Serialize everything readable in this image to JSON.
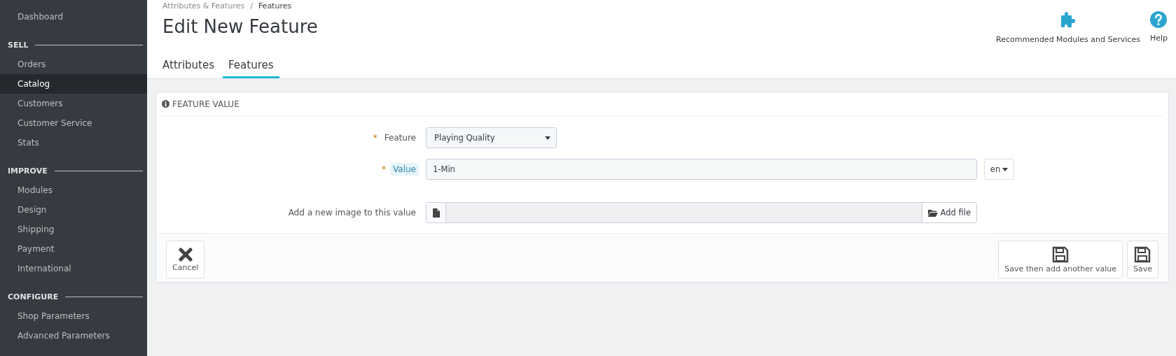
{
  "sidebar": {
    "items": [
      {
        "kind": "item",
        "label": "Dashboard",
        "selected": false
      },
      {
        "kind": "section",
        "label": "SELL"
      },
      {
        "kind": "item",
        "label": "Orders",
        "selected": false
      },
      {
        "kind": "item",
        "label": "Catalog",
        "selected": true
      },
      {
        "kind": "item",
        "label": "Customers",
        "selected": false
      },
      {
        "kind": "item",
        "label": "Customer Service",
        "selected": false
      },
      {
        "kind": "item",
        "label": "Stats",
        "selected": false
      },
      {
        "kind": "section",
        "label": "IMPROVE"
      },
      {
        "kind": "item",
        "label": "Modules",
        "selected": false
      },
      {
        "kind": "item",
        "label": "Design",
        "selected": false
      },
      {
        "kind": "item",
        "label": "Shipping",
        "selected": false
      },
      {
        "kind": "item",
        "label": "Payment",
        "selected": false
      },
      {
        "kind": "item",
        "label": "International",
        "selected": false
      },
      {
        "kind": "section",
        "label": "CONFIGURE"
      },
      {
        "kind": "item",
        "label": "Shop Parameters",
        "selected": false
      },
      {
        "kind": "item",
        "label": "Advanced Parameters",
        "selected": false
      }
    ]
  },
  "breadcrumb": [
    "Attributes & Features",
    "/",
    "Features"
  ],
  "title": "Edit New Feature",
  "toolbar": [
    {
      "kind": "puzzle",
      "label": "Recommended Modules and Services"
    },
    {
      "kind": "help",
      "label": "Help"
    }
  ],
  "tabs": [
    {
      "label": "Attributes",
      "selected": false
    },
    {
      "label": "Features",
      "selected": true
    }
  ],
  "panel": {
    "heading": "FEATURE VALUE",
    "fields": [
      {
        "kind": "select",
        "marker": "*",
        "label": "Feature",
        "highlighted": false,
        "value": "Playing Quality"
      },
      {
        "kind": "text",
        "marker": "*",
        "label": "Value",
        "highlighted": true,
        "value": "1-Min",
        "language": "en"
      },
      {
        "kind": "file",
        "label": "Add a new image to this value",
        "highlighted": false,
        "button": "Add file"
      }
    ],
    "buttons": [
      {
        "kind": "cancel",
        "label": "Cancel"
      },
      {
        "kind": "save",
        "label": "Save then add another value"
      },
      {
        "kind": "save",
        "label": "Save"
      }
    ]
  }
}
